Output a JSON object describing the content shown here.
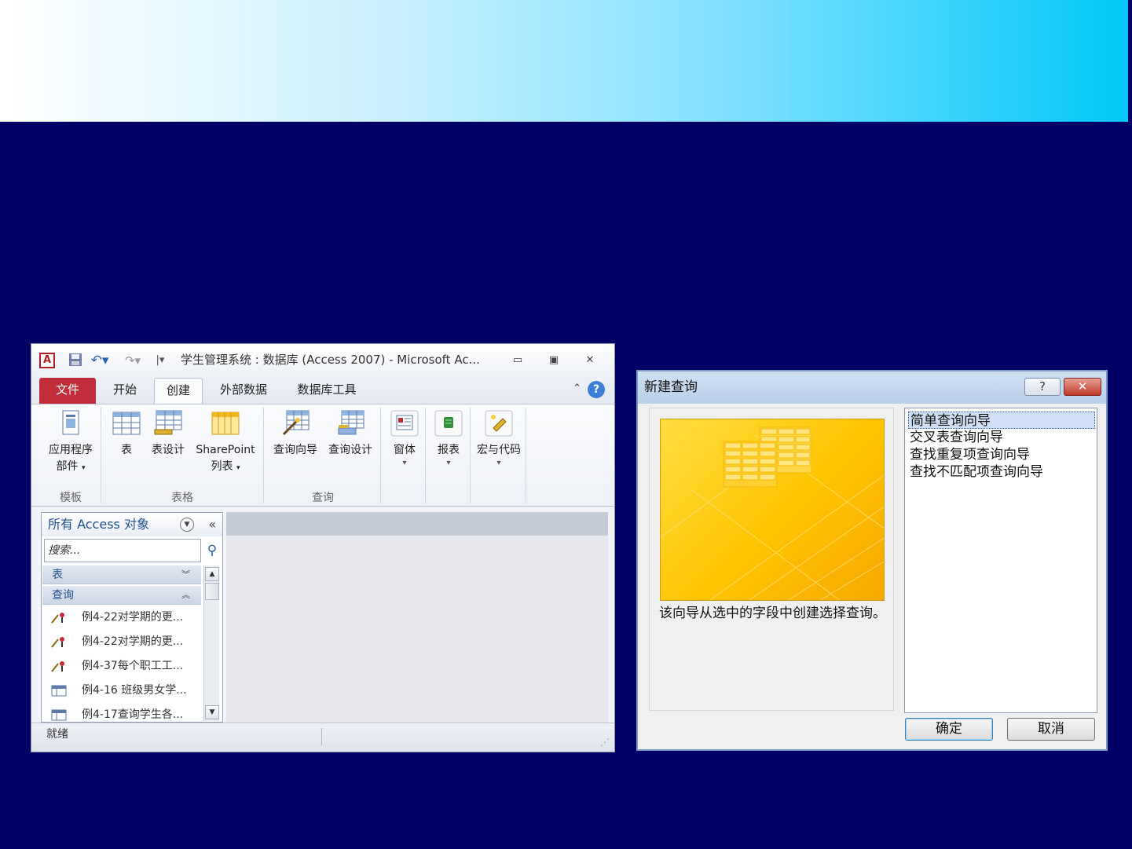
{
  "access": {
    "title": "学生管理系统 : 数据库 (Access 2007)  -  Microsoft Ac...",
    "logo_letter": "A",
    "tabs": {
      "file": "文件",
      "home": "开始",
      "create": "创建",
      "external": "外部数据",
      "dbtools": "数据库工具"
    },
    "ribbon": {
      "app_parts_l1": "应用程序",
      "app_parts_l2": "部件",
      "table": "表",
      "table_design": "表设计",
      "sharepoint_l1": "SharePoint",
      "sharepoint_l2": "列表",
      "query_wizard": "查询向导",
      "query_design": "查询设计",
      "form": "窗体",
      "report": "报表",
      "macro_code": "宏与代码",
      "group_templates": "模板",
      "group_tables": "表格",
      "group_queries": "查询"
    },
    "nav": {
      "header": "所有 Access 对象",
      "search_placeholder": "搜索...",
      "group_tables": "表",
      "group_queries": "查询",
      "items": [
        {
          "label": "例4-22对学期的更...",
          "icon": "update-query-icon"
        },
        {
          "label": "例4-22对学期的更...",
          "icon": "update-query-icon"
        },
        {
          "label": "例4-37每个职工工...",
          "icon": "update-query-icon"
        },
        {
          "label": "例4-16 班级男女学...",
          "icon": "select-query-icon"
        },
        {
          "label": "例4-17查询学生各...",
          "icon": "select-query-icon"
        }
      ]
    },
    "status": "就绪"
  },
  "dialog": {
    "title": "新建查询",
    "help": "?",
    "description": "该向导从选中的字段中创建选择查询。",
    "options": [
      "简单查询向导",
      "交叉表查询向导",
      "查找重复项查询向导",
      "查找不匹配项查询向导"
    ],
    "selected_index": 0,
    "ok": "确定",
    "cancel": "取消"
  },
  "colors": {
    "background": "#000066",
    "file_tab": "#c22d3b",
    "preview": "#ffc400"
  }
}
